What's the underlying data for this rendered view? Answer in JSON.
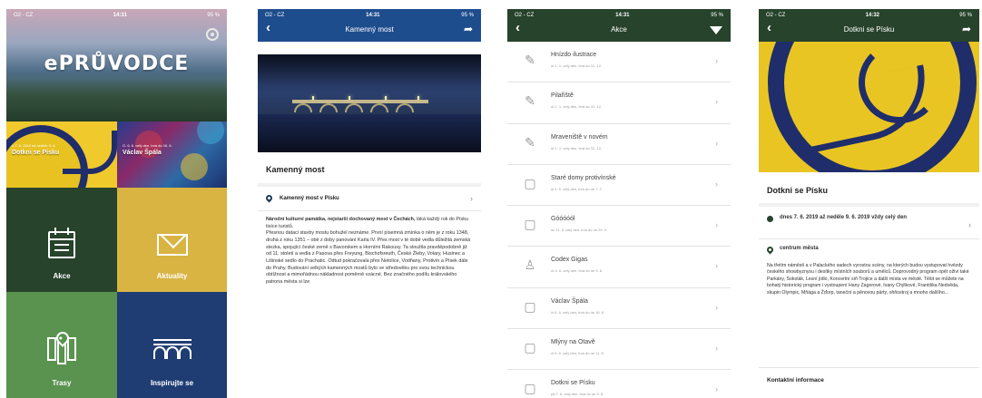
{
  "home": {
    "status": {
      "carrier": "O2 - CZ",
      "time": "14:31",
      "battery": "95 %"
    },
    "logo": "ePRŮVODCE",
    "featured": [
      {
        "small": "o 7. 6. 2019 až neděle 9. 6.",
        "title": "Dotkni se Písku"
      },
      {
        "small": "O. 6. 6. celý den, trvá do 16. 6.",
        "title": "Václav Špála"
      }
    ],
    "tiles": [
      {
        "label": "Akce",
        "icon": "calendar-icon",
        "color": "#27432b"
      },
      {
        "label": "Aktuality",
        "icon": "mail-icon",
        "color": "#d9b443"
      },
      {
        "label": "Trasy",
        "icon": "map-icon",
        "color": "#5a9250"
      },
      {
        "label": "Inspirujte se",
        "icon": "bridge-icon",
        "color": "#1f3d73"
      }
    ]
  },
  "detail": {
    "status": {
      "carrier": "O2 - CZ",
      "time": "14:31",
      "battery": "95 %"
    },
    "nav_title": "Kamenný most",
    "heading": "Kamenný most",
    "location": "Kamenný most v Písku",
    "lead_bold": "Národní kulturní památka, nejstarší dochovaný most v Čechách,",
    "lead_rest": " láká každý rok do Písku tisíce turistů.",
    "body": "Přesnou dataci stavby mostu bohužel neznáme. První písemná zmínka o něm je z roku 1348, druhá z roku 1351 – obě z doby panování Karla IV. Přes most v té době vedla důležitá zemská stezka, spojující české země s Bavorskem a Horními Rakousy. Ta sloužila pravděpodobně již od 11. století a vedla z Pasova přes Freyung, Bischofsreuth, České Žleby, Volary, Husinec a Lišinské sedlo do Prachatic. Odtud pokračovala přes Netolice, Vodňany, Protivín a Písek dále do Prahy. Budování velkých kamenných mostů bylo ve středověku pro svou technickou obtížnost a mimořádnou nákladnost poměrně vzácné. Bez značného podílu královského patrona města si lze"
  },
  "events": {
    "status": {
      "carrier": "O2 - CZ",
      "time": "14:31",
      "battery": "95 %"
    },
    "nav_title": "Akce",
    "items": [
      {
        "name": "Hnízdo ilustrace",
        "sub": "út 1. 1. celý den, trvá do 31. 12.",
        "icon": "✎"
      },
      {
        "name": "Pilařiště",
        "sub": "út 1. 1. celý den, trvá do 31. 12.",
        "icon": "✎"
      },
      {
        "name": "Mraveniště v novém",
        "sub": "út 1. 1. celý den, trvá do 31. 12.",
        "icon": "✎"
      },
      {
        "name": "Staré domy protivínské",
        "sub": "st 1. 5. celý den, trvá do ne 7. 7.",
        "icon": "▢"
      },
      {
        "name": "Góóóóól",
        "sub": "so 11. 5. celý den, trvá do ne 29. 9.",
        "icon": "▢"
      },
      {
        "name": "Codex Gigas",
        "sub": "út 4. 6. celý den, trvá do ne 9. 6.",
        "icon": "♙"
      },
      {
        "name": "Václav Špála",
        "sub": "čt 6. 6. celý den, trvá do ne 16. 6.",
        "icon": "▢"
      },
      {
        "name": "Mlýny na Otavě",
        "sub": "čt 6. 6. celý den, trvá do ne 11. 8.",
        "icon": "▢"
      },
      {
        "name": "Dotkni se Písku",
        "sub": "pá 7. 6. celý den, trvá do ne 9. 6.",
        "icon": "▢"
      }
    ]
  },
  "event_detail": {
    "status": {
      "carrier": "O2 - CZ",
      "time": "14:32",
      "battery": "95 %"
    },
    "nav_title": "Dotkni se Písku",
    "heading": "Dotkni se Písku",
    "date": "dnes 7. 6. 2019 až neděle 9. 6. 2019 vždy celý den",
    "place": "centrum města",
    "body": "Na třetím náměstí a v Palackého sadech vyrostou scény, na kterých budou vystupovat hvězdy českého showbyznysu i desítky místních souborů a umělců. Doprovodný program opět oživí také Parkány, Sokolák, Lesní jídlo, Koncertní síň Trojice a další místa ve městě. Těšit se můžete na bohatý historický program i vystoupení Hany Zagorové, Ivany Chýlkové, Františka Nedvěda, skupin Olympic, Mňága a Žďorp, taneční a pěnovou párty, ohňostroj a mnoho dalšího...",
    "contact_heading": "Kontaktní informace"
  }
}
